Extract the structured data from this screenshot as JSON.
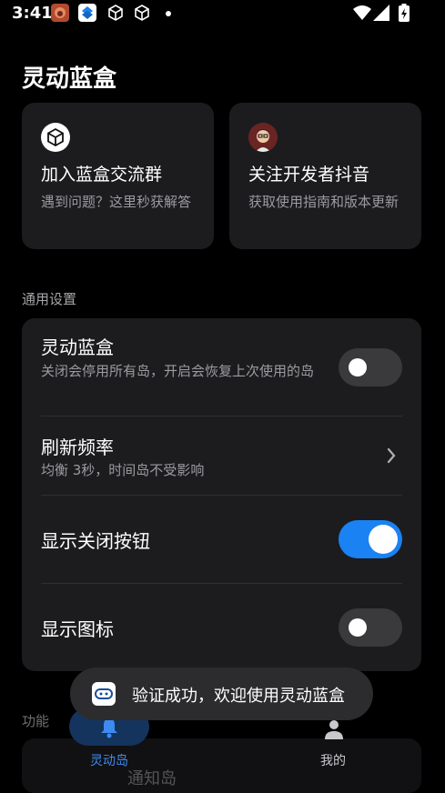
{
  "status_bar": {
    "time": "3:41",
    "icons": [
      "app-icon-red",
      "app-icon-blue",
      "box-icon",
      "box-icon",
      "dot-icon",
      "wifi-icon",
      "signal-icon",
      "battery-charging-icon"
    ]
  },
  "header": {
    "title": "灵动蓝盒"
  },
  "cards": [
    {
      "icon": "box-icon",
      "title": "加入蓝盒交流群",
      "desc": "遇到问题？这里秒获解答"
    },
    {
      "icon": "avatar-icon",
      "title": "关注开发者抖音",
      "desc": "获取使用指南和版本更新"
    }
  ],
  "general_settings": {
    "section_title": "通用设置",
    "rows": [
      {
        "title": "灵动蓝盒",
        "subtitle": "关闭会停用所有岛，开启会恢复上次使用的岛",
        "toggle": false
      },
      {
        "title": "刷新频率",
        "subtitle": "均衡 3秒，时间岛不受影响"
      },
      {
        "title": "显示关闭按钮",
        "toggle": true
      },
      {
        "title": "显示图标",
        "toggle": false
      }
    ]
  },
  "features": {
    "section_title": "功能",
    "first_item": "通知岛"
  },
  "bottom_nav": {
    "items": [
      {
        "label": "灵动岛",
        "icon": "bell-icon",
        "active": true
      },
      {
        "label": "我的",
        "icon": "person-icon",
        "active": false
      }
    ]
  },
  "toast": {
    "text": "验证成功，欢迎使用灵动蓝盒"
  },
  "colors": {
    "accent": "#1a82f2",
    "card_bg": "#1c1c1e",
    "background": "#000000"
  }
}
